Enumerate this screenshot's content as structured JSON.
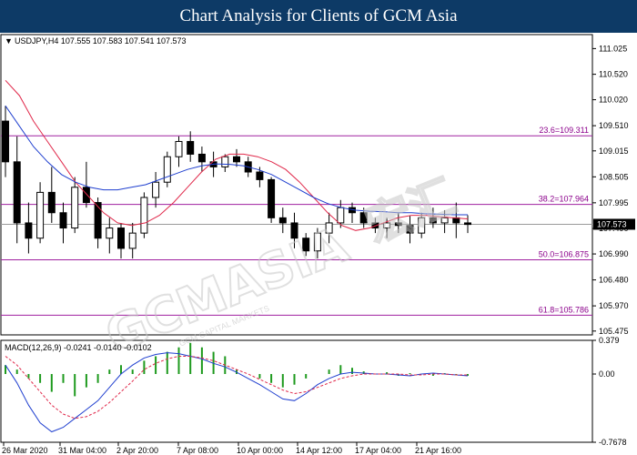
{
  "banner_title": "Chart Analysis for Clients of GCM Asia",
  "watermark": {
    "brand": "GCMASIA",
    "chinese": "宏汇",
    "tagline": "GCM CAPITAL MARKETS",
    "color": "#cfcfcf"
  },
  "chart_data": [
    {
      "type": "candlestick",
      "symbol_header": "USDJPY,H4  107.555 107.583 107.541 107.573",
      "current_price": 107.573,
      "current_price_label": "107.573",
      "ylim": [
        105.4,
        111.3
      ],
      "y_ticks": [
        "111.025",
        "110.520",
        "110.020",
        "109.510",
        "109.015",
        "108.505",
        "107.995",
        "107.490",
        "106.990",
        "106.480",
        "105.970",
        "105.475"
      ],
      "x_ticks": [
        "26 Mar 2020",
        "31 Mar 04:00",
        "2 Apr 20:00",
        "7 Apr 08:00",
        "10 Apr 00:00",
        "14 Apr 12:00",
        "17 Apr 04:00",
        "21 Apr 16:00"
      ],
      "fibonacci_levels": [
        {
          "label": "23.6=109.311",
          "value": 109.311
        },
        {
          "label": "38.2=107.964",
          "value": 107.964
        },
        {
          "label": "50.0=106.875",
          "value": 106.875
        },
        {
          "label": "61.8=105.786",
          "value": 105.786
        }
      ],
      "moving_averages": [
        {
          "color": "#e0284a",
          "values": [
            110.4,
            110.1,
            109.6,
            109.2,
            108.8,
            108.4,
            108.1,
            107.8,
            107.6,
            107.55,
            107.6,
            107.75,
            108.0,
            108.3,
            108.6,
            108.85,
            108.95,
            108.95,
            108.9,
            108.8,
            108.65,
            108.4,
            108.1,
            107.8,
            107.55,
            107.45,
            107.5,
            107.6,
            107.7,
            107.75,
            107.75,
            107.72,
            107.7,
            107.68
          ]
        },
        {
          "color": "#1f3fcf",
          "values": [
            109.9,
            109.5,
            109.1,
            108.8,
            108.55,
            108.4,
            108.3,
            108.25,
            108.25,
            108.3,
            108.35,
            108.45,
            108.55,
            108.65,
            108.72,
            108.76,
            108.75,
            108.72,
            108.65,
            108.55,
            108.4,
            108.25,
            108.1,
            107.98,
            107.9,
            107.85,
            107.83,
            107.82,
            107.8,
            107.8,
            107.78,
            107.77,
            107.76,
            107.76
          ]
        }
      ],
      "colors": {
        "fib_line": "#a020a0",
        "price_line": "#9a9a9a",
        "bull": "#ffffff",
        "bear": "#000000"
      },
      "ohlc": [
        [
          109.6,
          109.9,
          108.5,
          108.8
        ],
        [
          108.8,
          109.3,
          107.2,
          107.6
        ],
        [
          107.6,
          108.0,
          107.0,
          107.3
        ],
        [
          107.3,
          108.4,
          107.2,
          108.2
        ],
        [
          108.2,
          108.7,
          107.6,
          107.8
        ],
        [
          107.8,
          108.0,
          107.2,
          107.5
        ],
        [
          107.5,
          108.5,
          107.4,
          108.3
        ],
        [
          108.3,
          108.8,
          107.9,
          108.0
        ],
        [
          108.0,
          108.1,
          107.1,
          107.3
        ],
        [
          107.3,
          107.7,
          107.0,
          107.5
        ],
        [
          107.5,
          107.6,
          106.9,
          107.1
        ],
        [
          107.1,
          107.6,
          106.9,
          107.4
        ],
        [
          107.4,
          108.2,
          107.3,
          108.1
        ],
        [
          108.1,
          108.6,
          107.9,
          108.4
        ],
        [
          108.4,
          109.0,
          108.3,
          108.9
        ],
        [
          108.9,
          109.3,
          108.7,
          109.2
        ],
        [
          109.2,
          109.4,
          108.8,
          108.95
        ],
        [
          108.95,
          109.1,
          108.6,
          108.8
        ],
        [
          108.8,
          109.0,
          108.5,
          108.7
        ],
        [
          108.7,
          108.95,
          108.6,
          108.9
        ],
        [
          108.9,
          109.05,
          108.7,
          108.8
        ],
        [
          108.8,
          108.9,
          108.5,
          108.6
        ],
        [
          108.6,
          108.7,
          108.3,
          108.45
        ],
        [
          108.45,
          108.5,
          107.6,
          107.7
        ],
        [
          107.7,
          107.9,
          107.4,
          107.6
        ],
        [
          107.6,
          107.8,
          107.1,
          107.3
        ],
        [
          107.3,
          107.4,
          106.95,
          107.05
        ],
        [
          107.05,
          107.5,
          106.9,
          107.4
        ],
        [
          107.4,
          107.8,
          107.2,
          107.6
        ],
        [
          107.6,
          108.05,
          107.5,
          107.9
        ],
        [
          107.9,
          108.0,
          107.6,
          107.8
        ],
        [
          107.8,
          107.9,
          107.5,
          107.6
        ],
        [
          107.6,
          107.7,
          107.4,
          107.5
        ],
        [
          107.5,
          107.7,
          107.3,
          107.6
        ],
        [
          107.6,
          107.8,
          107.4,
          107.55
        ],
        [
          107.55,
          107.75,
          107.2,
          107.4
        ],
        [
          107.4,
          107.8,
          107.3,
          107.7
        ],
        [
          107.7,
          107.9,
          107.5,
          107.6
        ],
        [
          107.6,
          107.85,
          107.4,
          107.7
        ],
        [
          107.7,
          108.0,
          107.3,
          107.6
        ],
        [
          107.6,
          107.75,
          107.4,
          107.57
        ]
      ]
    },
    {
      "type": "macd",
      "header": "MACD(12,26,9) -0.0241 -0.0140 -0.0102",
      "ylim": [
        -0.7678,
        0.379
      ],
      "y_ticks": [
        {
          "label": "0.379",
          "value": 0.379
        },
        {
          "label": "0.00",
          "value": 0.0
        },
        {
          "label": "-0.7678",
          "value": -0.7678
        }
      ],
      "colors": {
        "histogram": "#1e9a1e",
        "macd": "#1f3fcf",
        "signal": "#e0284a"
      },
      "histogram": [
        0.1,
        0.05,
        -0.05,
        -0.1,
        -0.2,
        -0.1,
        -0.25,
        -0.15,
        -0.1,
        0.05,
        0.1,
        0.05,
        0.15,
        0.2,
        0.25,
        0.3,
        0.35,
        0.3,
        0.25,
        0.2,
        0.05,
        0.0,
        -0.05,
        -0.1,
        -0.15,
        -0.12,
        -0.05,
        0.0,
        0.05,
        0.1,
        0.07,
        0.03,
        0.0,
        0.02,
        -0.02,
        0.01,
        0.0,
        -0.02,
        0.01,
        -0.01,
        -0.02
      ],
      "macd_line": [
        0.1,
        -0.1,
        -0.35,
        -0.55,
        -0.65,
        -0.6,
        -0.5,
        -0.4,
        -0.3,
        -0.15,
        0.0,
        0.1,
        0.18,
        0.22,
        0.24,
        0.23,
        0.2,
        0.17,
        0.12,
        0.08,
        0.02,
        -0.05,
        -0.12,
        -0.2,
        -0.28,
        -0.3,
        -0.22,
        -0.12,
        -0.05,
        0.0,
        0.02,
        0.01,
        0.0,
        0.0,
        -0.01,
        -0.02,
        0.0,
        0.01,
        0.0,
        -0.01,
        -0.02
      ],
      "signal_line": [
        0.2,
        0.1,
        -0.05,
        -0.2,
        -0.35,
        -0.45,
        -0.5,
        -0.48,
        -0.42,
        -0.32,
        -0.2,
        -0.08,
        0.05,
        0.12,
        0.17,
        0.2,
        0.2,
        0.18,
        0.15,
        0.1,
        0.05,
        0.0,
        -0.06,
        -0.12,
        -0.18,
        -0.22,
        -0.2,
        -0.15,
        -0.1,
        -0.05,
        -0.02,
        0.0,
        0.0,
        0.0,
        0.0,
        -0.01,
        -0.01,
        0.0,
        0.0,
        -0.01,
        -0.01
      ]
    }
  ]
}
